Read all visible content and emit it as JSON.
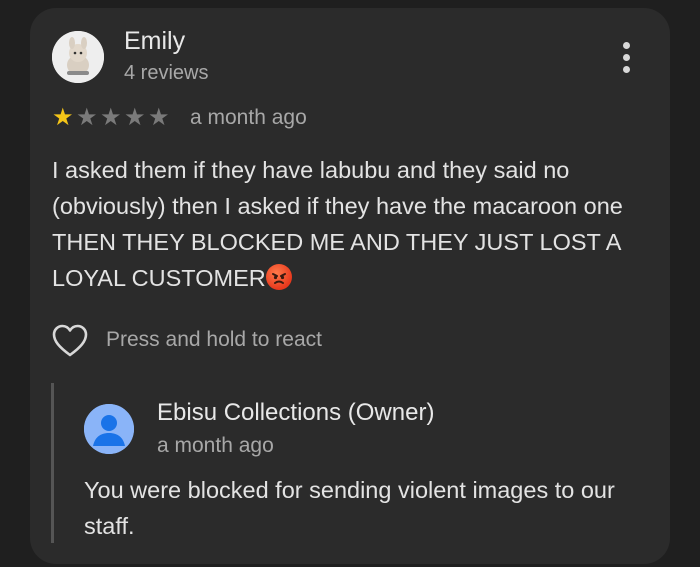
{
  "review": {
    "author_name": "Emily",
    "author_reviews": "4 reviews",
    "rating": 1,
    "rating_max": 5,
    "star_filled_color": "#f5c518",
    "star_empty_color": "#7a7a7a",
    "date": "a month ago",
    "text": "I asked them if they have labubu and they said no (obviously) then I asked if they have the macaroon one THEN THEY BLOCKED ME AND THEY JUST LOST A LOYAL CUSTOMER",
    "trailing_emoji": "angry-face-emoji",
    "react_hint": "Press and hold to react",
    "menu_icon": "more-vert-icon"
  },
  "owner_reply": {
    "owner_name": "Ebisu Collections (Owner)",
    "date": "a month ago",
    "text": "You were blocked for sending violent images to our staff.",
    "avatar_color": "#8ab4f8"
  }
}
